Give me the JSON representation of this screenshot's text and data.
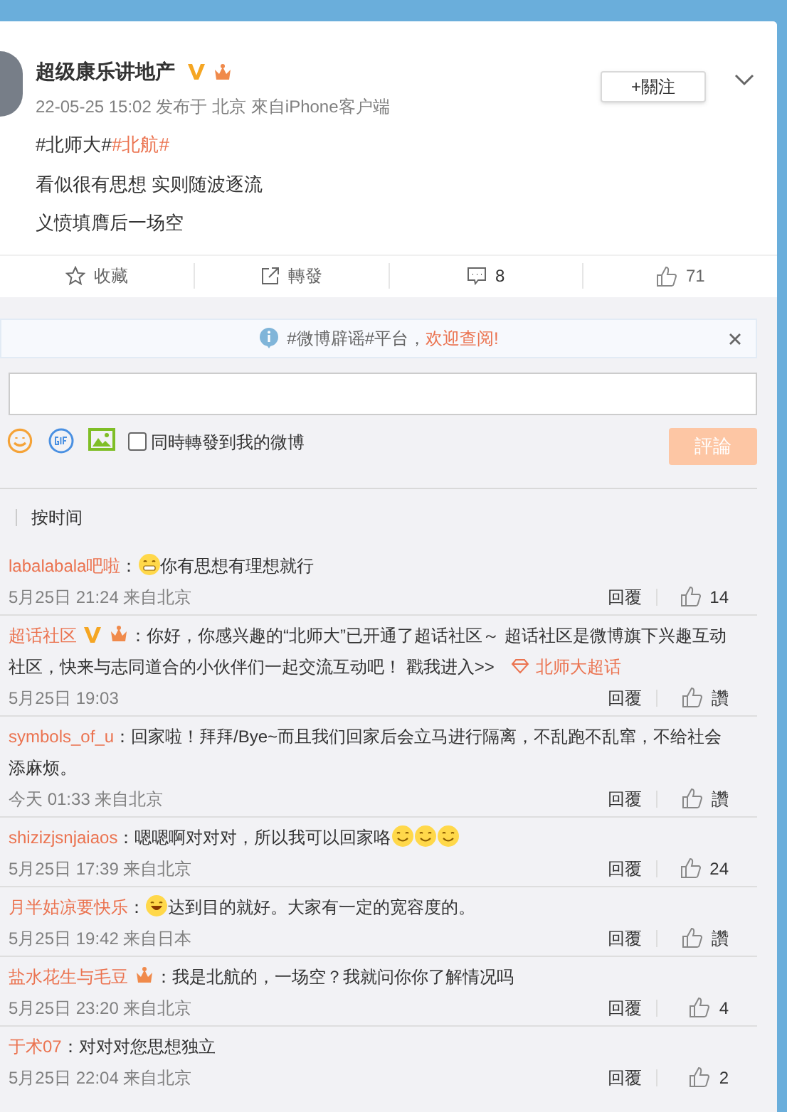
{
  "post": {
    "author": "超级康乐讲地产",
    "author_badges": [
      {
        "kind": "verified"
      },
      {
        "kind": "crown"
      }
    ],
    "follow_button": "+關注",
    "meta": "22-05-25 15:02 发布于 北京 來自iPhone客户端",
    "tags": [
      {
        "text": "#北师大#",
        "kind": "plain"
      },
      {
        "text": "#北航#",
        "kind": "link"
      }
    ],
    "lines": [
      "看似很有思想 实则随波逐流",
      "义愤填膺后一场空"
    ]
  },
  "actions": [
    {
      "kind": "star",
      "label": "收藏",
      "selected": false
    },
    {
      "kind": "share",
      "label": "轉發",
      "selected": false
    },
    {
      "kind": "comment",
      "label": "8",
      "selected": true
    },
    {
      "kind": "like",
      "label": "71",
      "selected": false
    }
  ],
  "notice": {
    "text": "#微博辟谣#平台，",
    "link": "欢迎查阅!"
  },
  "composer": {
    "repost_label": "同時轉發到我的微博",
    "repost_checked": false,
    "submit": "評論"
  },
  "sort": {
    "options": [
      {
        "label": "按时间",
        "selected": true
      }
    ]
  },
  "comments": [
    {
      "user": "labalabala吧啦",
      "colon": "：",
      "lead_emoji": {
        "kind": "grin"
      },
      "text": "你有思想有理想就行",
      "time": "5月25日 21:24 来自北京",
      "reply": "回覆",
      "likes": "14"
    },
    {
      "user": "超话社区",
      "badges": [
        {
          "kind": "verified"
        },
        {
          "kind": "crown"
        }
      ],
      "colon": "：",
      "text": "你好，你感兴趣的“北师大”已开通了超话社区～ 超话社区是微博旗下兴趣互动社区，快来与志同道合的小伙伴们一起交流互动吧！ 戳我进入>>",
      "topic_link": "北师大超话",
      "time": "5月25日 19:03",
      "reply": "回覆",
      "likes": "讚"
    },
    {
      "user": "symbols_of_u",
      "colon": "：",
      "text": "回家啦！拜拜/Bye~而且我们回家后会立马进行隔离，不乱跑不乱窜，不给社会添麻烦。",
      "time": "今天 01:33 来自北京",
      "reply": "回覆",
      "likes": "讚"
    },
    {
      "user": "shizizjsnjaiaos",
      "colon": "：",
      "text": "嗯嗯啊对对对，所以我可以回家咯",
      "trail_emojis": [
        {
          "kind": "smile"
        },
        {
          "kind": "smile"
        },
        {
          "kind": "smile"
        }
      ],
      "time": "5月25日 17:39 来自北京",
      "reply": "回覆",
      "likes": "24"
    },
    {
      "user": "月半姑凉要快乐",
      "colon": "：",
      "lead_emoji": {
        "kind": "laugh"
      },
      "text": "达到目的就好。大家有一定的宽容度的。",
      "time": "5月25日 19:42 来自日本",
      "reply": "回覆",
      "likes": "讚"
    },
    {
      "user": "盐水花生与毛豆",
      "badges": [
        {
          "kind": "crown"
        }
      ],
      "colon": "：",
      "text": "我是北航的，一场空？我就问你你了解情况吗",
      "time": "5月25日 23:20 来自北京",
      "reply": "回覆",
      "likes": "4"
    },
    {
      "user": "于术07",
      "colon": "：",
      "text": "对对对您思想独立",
      "time": "5月25日 22:04 来自北京",
      "reply": "回覆",
      "likes": "2"
    }
  ]
}
